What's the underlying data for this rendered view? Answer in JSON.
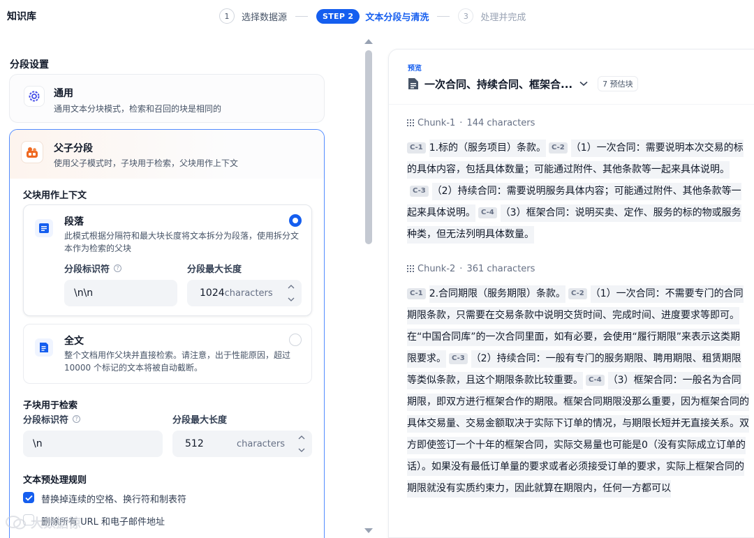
{
  "header": {
    "title": "知识库",
    "steps": [
      {
        "num": "1",
        "label": "选择数据源"
      },
      {
        "pill": "STEP 2",
        "label": "文本分段与清洗"
      },
      {
        "num": "3",
        "label": "处理并完成"
      }
    ]
  },
  "settings": {
    "title": "分段设置",
    "general": {
      "title": "通用",
      "desc": "通用文本分块模式，检索和召回的块是相同的"
    },
    "parent_child": {
      "title": "父子分段",
      "desc": "使用父子模式时，子块用于检索，父块用作上下文",
      "parent_section_title": "父块用作上下文",
      "paragraph": {
        "title": "段落",
        "desc": "此模式根据分隔符和最大块长度将文本拆分为段落，使用拆分文本作为检索的父块",
        "separator_label": "分段标识符",
        "separator_value": "\\n\\n",
        "maxlen_label": "分段最大长度",
        "maxlen_value": "1024",
        "maxlen_unit": "characters",
        "selected": true
      },
      "fulltext": {
        "title": "全文",
        "desc": "整个文档用作父块并直接检索。请注意，出于性能原因，超过 10000 个标记的文本将被自动截断。",
        "selected": false
      },
      "child_section_title": "子块用于检索",
      "child": {
        "separator_label": "分段标识符",
        "separator_value": "\\n",
        "maxlen_label": "分段最大长度",
        "maxlen_value": "512",
        "maxlen_unit": "characters"
      },
      "preprocess": {
        "title": "文本预处理规则",
        "rules": [
          {
            "label": "替换掉连续的空格、换行符和制表符",
            "checked": true
          },
          {
            "label": "删除所有 URL 和电子邮件地址",
            "checked": false
          }
        ]
      }
    }
  },
  "preview": {
    "tag": "预览",
    "doc_title": "一次合同、持续合同、框架合...",
    "chunk_count": "7 预估块",
    "chunks": [
      {
        "label": "Chunk-1",
        "chars": "144 characters",
        "segments": [
          {
            "tag": "C-1",
            "text": "1.标的（服务项目）条款。"
          },
          {
            "tag": "C-2",
            "text": "（1）一次合同：需要说明本次交易的标的具体内容，包括具体数量；可能通过附件、其他条款等一起来具体说明。"
          },
          {
            "tag": "C-3",
            "text": "（2）持续合同：需要说明服务具体内容；可能通过附件、其他条款等一起来具体说明。"
          },
          {
            "tag": "C-4",
            "text": "（3）框架合同：说明买卖、定作、服务的标的物或服务种类，但无法列明具体数量。"
          }
        ]
      },
      {
        "label": "Chunk-2",
        "chars": "361 characters",
        "segments": [
          {
            "tag": "C-1",
            "text": "2.合同期限（服务期限）条款。"
          },
          {
            "tag": "C-2",
            "text": "（1）一次合同：不需要专门的合同期限条款，只需要在交易条款中说明交货时间、完成时间、进度要求等即可。在“中国合同库”的一次合同里面，如有必要，会使用“履行期限”来表示这类期限要求。"
          },
          {
            "tag": "C-3",
            "text": "（2）持续合同：一般有专门的服务期限、聘用期限、租赁期限等类似条款，且这个期限条款比较重要。"
          },
          {
            "tag": "C-4",
            "text": "（3）框架合同：一般名为合同期限，即双方进行框架合作的期限。框架合同期限没那么重要，因为框架合同的具体交易量、交易金额取决于实际下订单的情况，与期限长短并无直接关系。双方即使签订一个十年的框架合同，实际交易量也可能是0（没有实际成立订单的话）。如果没有最低订单量的要求或者必须接受订单的要求，实际上框架合同的期限就没有实质约束力，因此就算在期限内，任何一方都可以"
          }
        ]
      }
    ]
  },
  "watermark": "大数据惊",
  "colors": {
    "accent": "#155eef",
    "accent_border": "#528bff",
    "segment_bg": "#f2f4f7"
  }
}
